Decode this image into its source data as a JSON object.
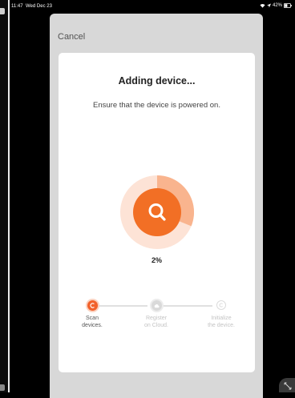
{
  "status_bar": {
    "time": "11:47",
    "date": "Wed Dec 23",
    "battery_percent": "42%",
    "icons": [
      "wifi-icon",
      "location-icon",
      "battery-icon"
    ]
  },
  "header": {
    "cancel_label": "Cancel"
  },
  "card": {
    "title": "Adding device...",
    "subtitle": "Ensure that the device is powered on.",
    "progress_text": "2%",
    "search_icon": "search-icon"
  },
  "steps": [
    {
      "label": "Scan\ndevices.",
      "state": "active",
      "icon": "scan-icon"
    },
    {
      "label": "Register\non Cloud.",
      "state": "inactive",
      "icon": "cloud-icon"
    },
    {
      "label": "Initialize\nthe device.",
      "state": "inactive",
      "icon": "initialize-icon"
    }
  ],
  "colors": {
    "accent": "#f2612b",
    "accent_light": "#f9b48e",
    "sheet_bg": "#d8d8d8",
    "card_bg": "#ffffff"
  },
  "corner_button_icon": "resize-icon"
}
